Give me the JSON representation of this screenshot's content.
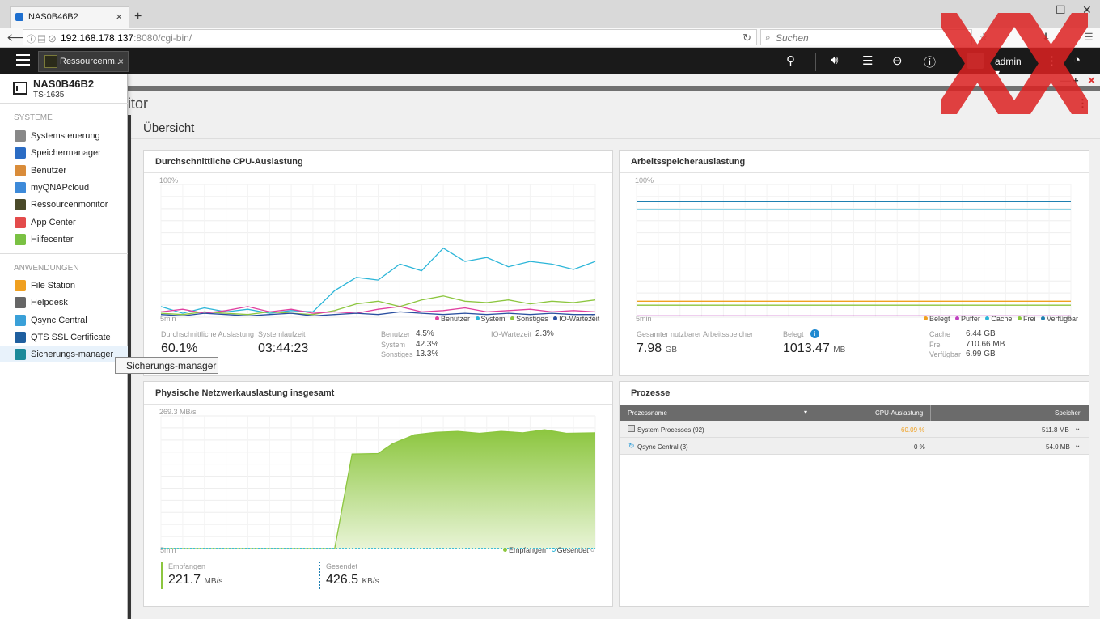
{
  "browser": {
    "tab_title": "NAS0B46B2",
    "url_host": "192.168.178.137",
    "url_rest": ":8080/cgi-bin/",
    "search_placeholder": "Suchen"
  },
  "topbar": {
    "app_tab_title": "Ressourcenm...",
    "user": "admin ▾"
  },
  "sidebar": {
    "nas_name": "NAS0B46B2",
    "model": "TS-1635",
    "section_system": "SYSTEME",
    "system_items": [
      {
        "label": "Systemsteuerung",
        "icon": "gear-icon",
        "color": "#888888"
      },
      {
        "label": "Speichermanager",
        "icon": "database-icon",
        "color": "#2b6cc4"
      },
      {
        "label": "Benutzer",
        "icon": "user-icon",
        "color": "#d98c3a"
      },
      {
        "label": "myQNAPcloud",
        "icon": "cloud-icon",
        "color": "#3d8ad9"
      },
      {
        "label": "Ressourcenmonitor",
        "icon": "monitor-icon",
        "color": "#4a4a2a"
      },
      {
        "label": "App Center",
        "icon": "apps-icon",
        "color": "#e34b4b"
      },
      {
        "label": "Hilfecenter",
        "icon": "help-icon",
        "color": "#7ac143"
      }
    ],
    "section_apps": "ANWENDUNGEN",
    "app_items": [
      {
        "label": "File Station",
        "icon": "folder-icon",
        "color": "#f0a020"
      },
      {
        "label": "Helpdesk",
        "icon": "helpdesk-icon",
        "color": "#666666"
      },
      {
        "label": "Qsync Central",
        "icon": "sync-icon",
        "color": "#3aa0d8"
      },
      {
        "label": "QTS SSL Certificate",
        "icon": "certificate-icon",
        "color": "#1f5f9f"
      },
      {
        "label": "Sicherungs-manager",
        "icon": "backup-icon",
        "color": "#1c8a9a"
      }
    ],
    "tooltip": "Sicherungs-manager"
  },
  "main": {
    "app_title": "nitor",
    "section_title": "Übersicht"
  },
  "cpu": {
    "title": "Durchschnittliche CPU-Auslastung",
    "y_max_label": "100%",
    "x_start_label": "5min",
    "x_end_label": "0",
    "legend": [
      "Benutzer",
      "System",
      "Sonstiges",
      "IO-Wartezeit"
    ],
    "avg_label": "Durchschnittliche Auslastung",
    "avg_value": "60.1%",
    "uptime_label": "Systemlaufzeit",
    "uptime_value": "03:44:23",
    "user_label": "Benutzer",
    "user_value": "4.5%",
    "system_label": "System",
    "system_value": "42.3%",
    "other_label": "Sonstiges",
    "other_value": "13.3%",
    "io_label": "IO-Wartezeit",
    "io_value": "2.3%"
  },
  "memory": {
    "title": "Arbeitsspeicherauslastung",
    "y_max_label": "100%",
    "x_start_label": "5min",
    "x_end_label": "0",
    "legend": [
      "Belegt",
      "Puffer",
      "Cache",
      "Frei",
      "Verfügbar"
    ],
    "total_label": "Gesamter nutzbarer Arbeitsspeicher",
    "total_value": "7.98",
    "total_unit": "GB",
    "used_label": "Belegt",
    "used_value": "1013.47",
    "used_unit": "MB",
    "cache_label": "Cache",
    "cache_value": "6.44 GB",
    "free_label": "Frei",
    "free_value": "710.66 MB",
    "avail_label": "Verfügbar",
    "avail_value": "6.99 GB"
  },
  "network": {
    "title": "Physische Netzwerkauslastung insgesamt",
    "y_max_label": "269.3 MB/s",
    "x_start_label": "5min",
    "x_end_label": "0",
    "legend": [
      "Empfangen",
      "Gesendet"
    ],
    "rx_label": "Empfangen",
    "rx_value": "221.7",
    "rx_unit": "MB/s",
    "tx_label": "Gesendet",
    "tx_value": "426.5",
    "tx_unit": "KB/s"
  },
  "processes": {
    "title": "Prozesse",
    "columns": [
      "Prozessname",
      "CPU-Auslastung",
      "Speicher"
    ],
    "rows": [
      {
        "name": "System Processes (92)",
        "cpu": "60.09 %",
        "mem": "511.8 MB"
      },
      {
        "name": "Qsync Central (3)",
        "cpu": "0 %",
        "mem": "54.0 MB"
      }
    ]
  },
  "colors": {
    "user": "#e040a0",
    "system": "#2bb5d8",
    "other": "#8cc63f",
    "io": "#2a4fa0",
    "mem_used": "#f0a020",
    "mem_buffer": "#c040c0",
    "mem_cache": "#2bb5d8",
    "mem_free": "#8cc63f",
    "mem_avail": "#1f7fb0",
    "net_rx": "#8cc63f",
    "cpu_highlight": "#f0a020"
  },
  "chart_data": [
    {
      "type": "line",
      "title": "Durchschnittliche CPU-Auslastung",
      "ylim": [
        0,
        100
      ],
      "x": [
        300,
        285,
        270,
        255,
        240,
        225,
        210,
        195,
        180,
        165,
        150,
        135,
        120,
        105,
        90,
        75,
        60,
        45,
        30,
        15,
        0
      ],
      "series": [
        {
          "name": "System",
          "values": [
            8,
            3,
            7,
            4,
            6,
            3,
            5,
            4,
            20,
            30,
            28,
            40,
            35,
            52,
            42,
            45,
            38,
            42,
            40,
            36,
            42
          ]
        },
        {
          "name": "Sonstiges",
          "values": [
            3,
            2,
            4,
            3,
            2,
            4,
            3,
            2,
            5,
            10,
            12,
            8,
            13,
            16,
            12,
            11,
            13,
            10,
            12,
            11,
            13
          ]
        },
        {
          "name": "Benutzer",
          "values": [
            4,
            6,
            3,
            5,
            8,
            4,
            6,
            3,
            4,
            3,
            6,
            8,
            4,
            5,
            7,
            4,
            5,
            6,
            4,
            5,
            4
          ]
        },
        {
          "name": "IO-Wartezeit",
          "values": [
            2,
            1,
            3,
            2,
            1,
            2,
            3,
            1,
            2,
            3,
            2,
            4,
            3,
            2,
            3,
            2,
            3,
            2,
            3,
            2,
            2
          ]
        }
      ]
    },
    {
      "type": "line",
      "title": "Arbeitsspeicherauslastung",
      "ylim": [
        0,
        100
      ],
      "x": [
        300,
        0
      ],
      "series": [
        {
          "name": "Verfügbar",
          "values": [
            87,
            87
          ]
        },
        {
          "name": "Cache",
          "values": [
            81,
            81
          ]
        },
        {
          "name": "Belegt",
          "values": [
            12,
            12
          ]
        },
        {
          "name": "Frei",
          "values": [
            9,
            9
          ]
        },
        {
          "name": "Puffer",
          "values": [
            1,
            1
          ]
        }
      ]
    },
    {
      "type": "area",
      "title": "Physische Netzwerkauslastung insgesamt",
      "ylim": [
        0,
        269.3
      ],
      "x": [
        300,
        180,
        168,
        150,
        140,
        125,
        110,
        95,
        80,
        65,
        50,
        35,
        20,
        0
      ],
      "series": [
        {
          "name": "Empfangen",
          "values": [
            0,
            0,
            192,
            193,
            213,
            231,
            236,
            238,
            234,
            238,
            235,
            241,
            234,
            235
          ]
        },
        {
          "name": "Gesendet",
          "values": [
            0.4,
            0.4,
            0.4,
            0.4,
            0.4,
            0.4,
            0.4,
            0.4,
            0.4,
            0.4,
            0.4,
            0.4,
            0.4,
            0.4
          ]
        }
      ]
    }
  ]
}
